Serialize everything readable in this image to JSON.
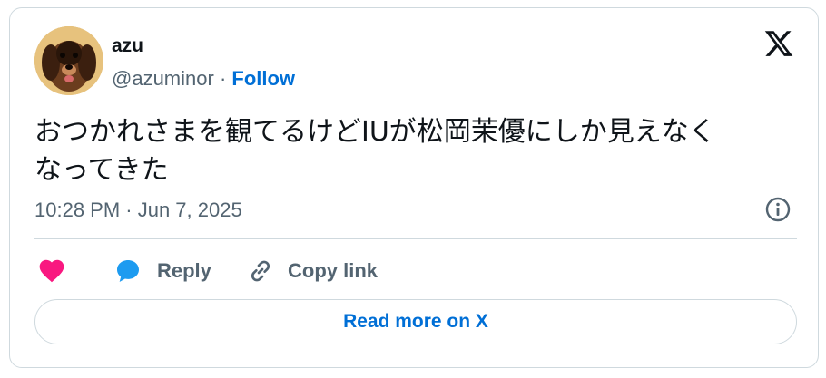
{
  "author": {
    "name": "azu",
    "handle": "@azuminor",
    "separator": " · ",
    "follow_label": "Follow"
  },
  "tweet": {
    "text_line1": "おつかれさまを観てるけどIUが松岡茉優にしか見えなく",
    "text_line2": "なってきた",
    "timestamp": "10:28 PM · Jun 7, 2025"
  },
  "actions": {
    "like_icon": "heart-icon",
    "reply_label": "Reply",
    "copy_link_label": "Copy link"
  },
  "footer": {
    "read_more_label": "Read more on X"
  },
  "colors": {
    "like": "#f91880",
    "reply": "#1d9bf0",
    "link": "#006fd6",
    "secondary_text": "#536471",
    "primary_text": "#0f1419",
    "border": "#cfd9de"
  }
}
